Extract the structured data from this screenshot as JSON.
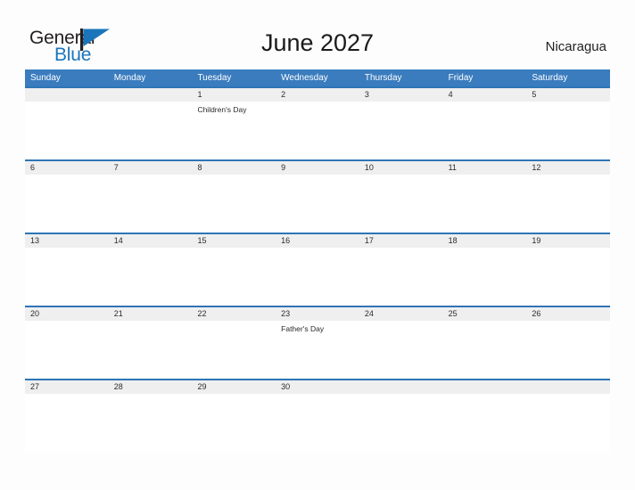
{
  "branding": {
    "logo_word_1": "General",
    "logo_word_2": "Blue",
    "logo_icon": "blue-flag-triangle",
    "logo_color": "#1b75bb",
    "logo_text_color": "#231f20"
  },
  "header": {
    "title": "June 2027",
    "country": "Nicaragua"
  },
  "colors": {
    "header_blue": "#3a7cbe",
    "divider_blue": "#2e75b6",
    "date_band_gray": "#efefef",
    "page_background": "#fdfdfd",
    "text": "#2b2b2b"
  },
  "calendar": {
    "month": "June",
    "year": "2027",
    "weekday_headers": [
      "Sunday",
      "Monday",
      "Tuesday",
      "Wednesday",
      "Thursday",
      "Friday",
      "Saturday"
    ],
    "weeks": [
      {
        "days": [
          {
            "date": "",
            "event": ""
          },
          {
            "date": "",
            "event": ""
          },
          {
            "date": "1",
            "event": "Children's Day"
          },
          {
            "date": "2",
            "event": ""
          },
          {
            "date": "3",
            "event": ""
          },
          {
            "date": "4",
            "event": ""
          },
          {
            "date": "5",
            "event": ""
          }
        ]
      },
      {
        "days": [
          {
            "date": "6",
            "event": ""
          },
          {
            "date": "7",
            "event": ""
          },
          {
            "date": "8",
            "event": ""
          },
          {
            "date": "9",
            "event": ""
          },
          {
            "date": "10",
            "event": ""
          },
          {
            "date": "11",
            "event": ""
          },
          {
            "date": "12",
            "event": ""
          }
        ]
      },
      {
        "days": [
          {
            "date": "13",
            "event": ""
          },
          {
            "date": "14",
            "event": ""
          },
          {
            "date": "15",
            "event": ""
          },
          {
            "date": "16",
            "event": ""
          },
          {
            "date": "17",
            "event": ""
          },
          {
            "date": "18",
            "event": ""
          },
          {
            "date": "19",
            "event": ""
          }
        ]
      },
      {
        "days": [
          {
            "date": "20",
            "event": ""
          },
          {
            "date": "21",
            "event": ""
          },
          {
            "date": "22",
            "event": ""
          },
          {
            "date": "23",
            "event": "Father's Day"
          },
          {
            "date": "24",
            "event": ""
          },
          {
            "date": "25",
            "event": ""
          },
          {
            "date": "26",
            "event": ""
          }
        ]
      },
      {
        "days": [
          {
            "date": "27",
            "event": ""
          },
          {
            "date": "28",
            "event": ""
          },
          {
            "date": "29",
            "event": ""
          },
          {
            "date": "30",
            "event": ""
          },
          {
            "date": "",
            "event": ""
          },
          {
            "date": "",
            "event": ""
          },
          {
            "date": "",
            "event": ""
          }
        ]
      }
    ]
  }
}
